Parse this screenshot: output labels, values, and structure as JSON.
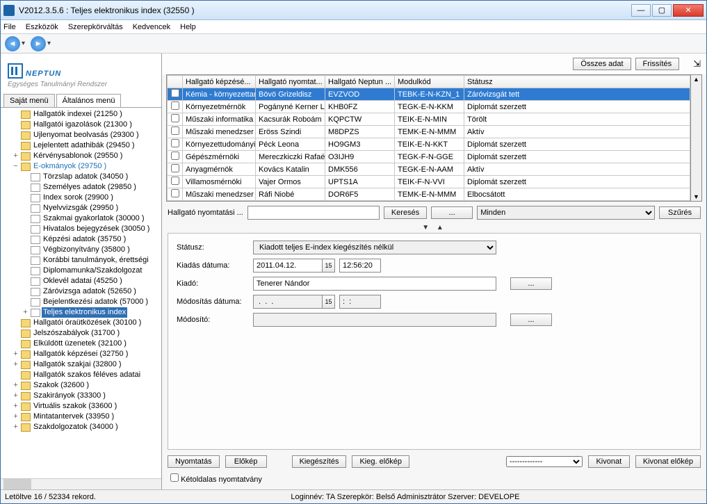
{
  "window": {
    "title": "V2012.3.5.6 : Teljes elektronikus index (32550  )"
  },
  "menu": {
    "file": "File",
    "tools": "Eszközök",
    "role": "Szerepkörváltás",
    "fav": "Kedvencek",
    "help": "Help"
  },
  "logo": {
    "name": "NEPTUN",
    "sub": "Egységes Tanulmányi Rendszer"
  },
  "side_tabs": {
    "own": "Saját menü",
    "general": "Általános menü"
  },
  "tree": [
    {
      "t": "Hallgatók indexei (21250  )",
      "cls": "indent1",
      "exp": ""
    },
    {
      "t": "Hallgatói igazolások (21300  )",
      "cls": "indent1",
      "exp": ""
    },
    {
      "t": "Ujlenyomat beolvasás (29300  )",
      "cls": "indent1",
      "exp": ""
    },
    {
      "t": "Lejelentett adathibák (29450  )",
      "cls": "indent1",
      "exp": ""
    },
    {
      "t": "Kérvénysablonok (29550  )",
      "cls": "indent1",
      "exp": "+"
    },
    {
      "t": "E-okmányok (29750  )",
      "cls": "indent1 eok",
      "exp": "−"
    },
    {
      "t": "Törzslap adatok (34050  )",
      "cls": "indent2 doc",
      "exp": ""
    },
    {
      "t": "Személyes adatok (29850  )",
      "cls": "indent2 doc",
      "exp": ""
    },
    {
      "t": "Index sorok (29900  )",
      "cls": "indent2 doc",
      "exp": ""
    },
    {
      "t": "Nyelvvizsgák (29950  )",
      "cls": "indent2 doc",
      "exp": ""
    },
    {
      "t": "Szakmai gyakorlatok (30000  )",
      "cls": "indent2 doc",
      "exp": ""
    },
    {
      "t": "Hivatalos bejegyzések (30050  )",
      "cls": "indent2 doc",
      "exp": ""
    },
    {
      "t": "Képzési adatok (35750  )",
      "cls": "indent2 doc",
      "exp": ""
    },
    {
      "t": "Végbizonyítvány (35800  )",
      "cls": "indent2 doc",
      "exp": ""
    },
    {
      "t": "Korábbi tanulmányok, érettségi",
      "cls": "indent2 doc",
      "exp": ""
    },
    {
      "t": "Diplomamunka/Szakdolgozat",
      "cls": "indent2 doc",
      "exp": ""
    },
    {
      "t": "Oklevél adatai (45250  )",
      "cls": "indent2 doc",
      "exp": ""
    },
    {
      "t": "Záróvizsga adatok (52650  )",
      "cls": "indent2 doc",
      "exp": ""
    },
    {
      "t": "Bejelentkezési adatok (57000  )",
      "cls": "indent2 doc",
      "exp": ""
    },
    {
      "t": "Teljes elektronikus index",
      "cls": "indent2 doc selected",
      "exp": "+"
    },
    {
      "t": "Hallgatói óraütközések (30100  )",
      "cls": "indent1",
      "exp": ""
    },
    {
      "t": "Jelszószabályok (31700  )",
      "cls": "indent1",
      "exp": ""
    },
    {
      "t": "Elküldött üzenetek (32100  )",
      "cls": "indent1",
      "exp": ""
    },
    {
      "t": "Hallgatók képzései (32750  )",
      "cls": "indent1",
      "exp": "+"
    },
    {
      "t": "Hallgatók szakjai (32800  )",
      "cls": "indent1",
      "exp": "+"
    },
    {
      "t": "Hallgatók szakos féléves adatai",
      "cls": "indent1",
      "exp": ""
    },
    {
      "t": "Szakok (32600  )",
      "cls": "indent1",
      "exp": "+"
    },
    {
      "t": "Szakirányok (33300  )",
      "cls": "indent1",
      "exp": "+"
    },
    {
      "t": "Virtuális szakok (33600  )",
      "cls": "indent1",
      "exp": "+"
    },
    {
      "t": "Mintatantervek (33950  )",
      "cls": "indent1",
      "exp": "+"
    },
    {
      "t": "Szakdolgozatok (34000  )",
      "cls": "indent1",
      "exp": "+"
    }
  ],
  "topbuttons": {
    "all": "Összes adat",
    "refresh": "Frissítés"
  },
  "grid": {
    "headers": [
      "",
      "Hallgató képzésé...",
      "Hallgató nyomtat...",
      "Hallgató Neptun ...",
      "Modulkód",
      "Státusz"
    ],
    "rows": [
      [
        "Kémia - környezettan",
        "Bövö Grizeldisz",
        "EVZVOD",
        "TEBK-E-N-KZN_1",
        "Záróvizsgát tett"
      ],
      [
        "Környezetmérnök",
        "Pogányné Kerner Loretta",
        "KHB0FZ",
        "TEGK-E-N-KKM",
        "Diplomát szerzett"
      ],
      [
        "Műszaki informatika",
        "Kacsurák Roboám",
        "KQPCTW",
        "TEIK-E-N-MIN",
        "Törölt"
      ],
      [
        "Műszaki menedzser",
        "Eröss Szindi",
        "M8DPZS",
        "TEMK-E-N-MMM",
        "Aktív"
      ],
      [
        "Környezettudományi",
        "Péck Leona",
        "HO9GM3",
        "TEIK-E-N-KKT",
        "Diplomát szerzett"
      ],
      [
        "Gépészmérnöki",
        "Mereczkiczki Rafaéla",
        "O3IJH9",
        "TEGK-F-N-GGE",
        "Diplomát szerzett"
      ],
      [
        "Anyagmérnök",
        "Kovács Katalin",
        "DMK556",
        "TEGK-E-N-AAM",
        "Aktív"
      ],
      [
        "Villamosmérnöki",
        "Vajer Ormos",
        "UPTS1A",
        "TEIK-F-N-VVI",
        "Diplomát szerzett"
      ],
      [
        "Műszaki menedzser",
        "Ráfi Niobé",
        "DOR6F5",
        "TEMK-E-N-MMM",
        "Elbocsátott"
      ]
    ]
  },
  "search": {
    "label": "Hallgató nyomtatási ...",
    "btn": "Keresés",
    "dots": "...",
    "combo": "Minden",
    "filter": "Szűrés"
  },
  "form": {
    "status_l": "Státusz:",
    "status_v": "Kiadott teljes E-index kiegészítés nélkül",
    "kiad_l": "Kiadás dátuma:",
    "kiad_d": "2011.04.12.",
    "kiad_t": "12:56:20",
    "kiado_l": "Kiadó:",
    "kiado_v": "Tenerer Nándor",
    "mod_l": "Módosítás dátuma:",
    "mod_d": " .  .  .",
    "mod_t": ":  :",
    "modby_l": "Módosító:",
    "modby_v": ""
  },
  "buttons": {
    "print": "Nyomtatás",
    "preview": "Előkép",
    "supp": "Kiegészítés",
    "supprev": "Kieg. előkép",
    "combo": "-------------",
    "kiv": "Kivonat",
    "kivprev": "Kivonat előkép"
  },
  "check": {
    "label": "Kétoldalas nyomtatvány"
  },
  "status": {
    "left": "Letöltve 16 / 52334 rekord.",
    "mid": "Loginnév: TA    Szerepkör: Belső Adminisztrátor    Szerver: DEVELOPE"
  }
}
